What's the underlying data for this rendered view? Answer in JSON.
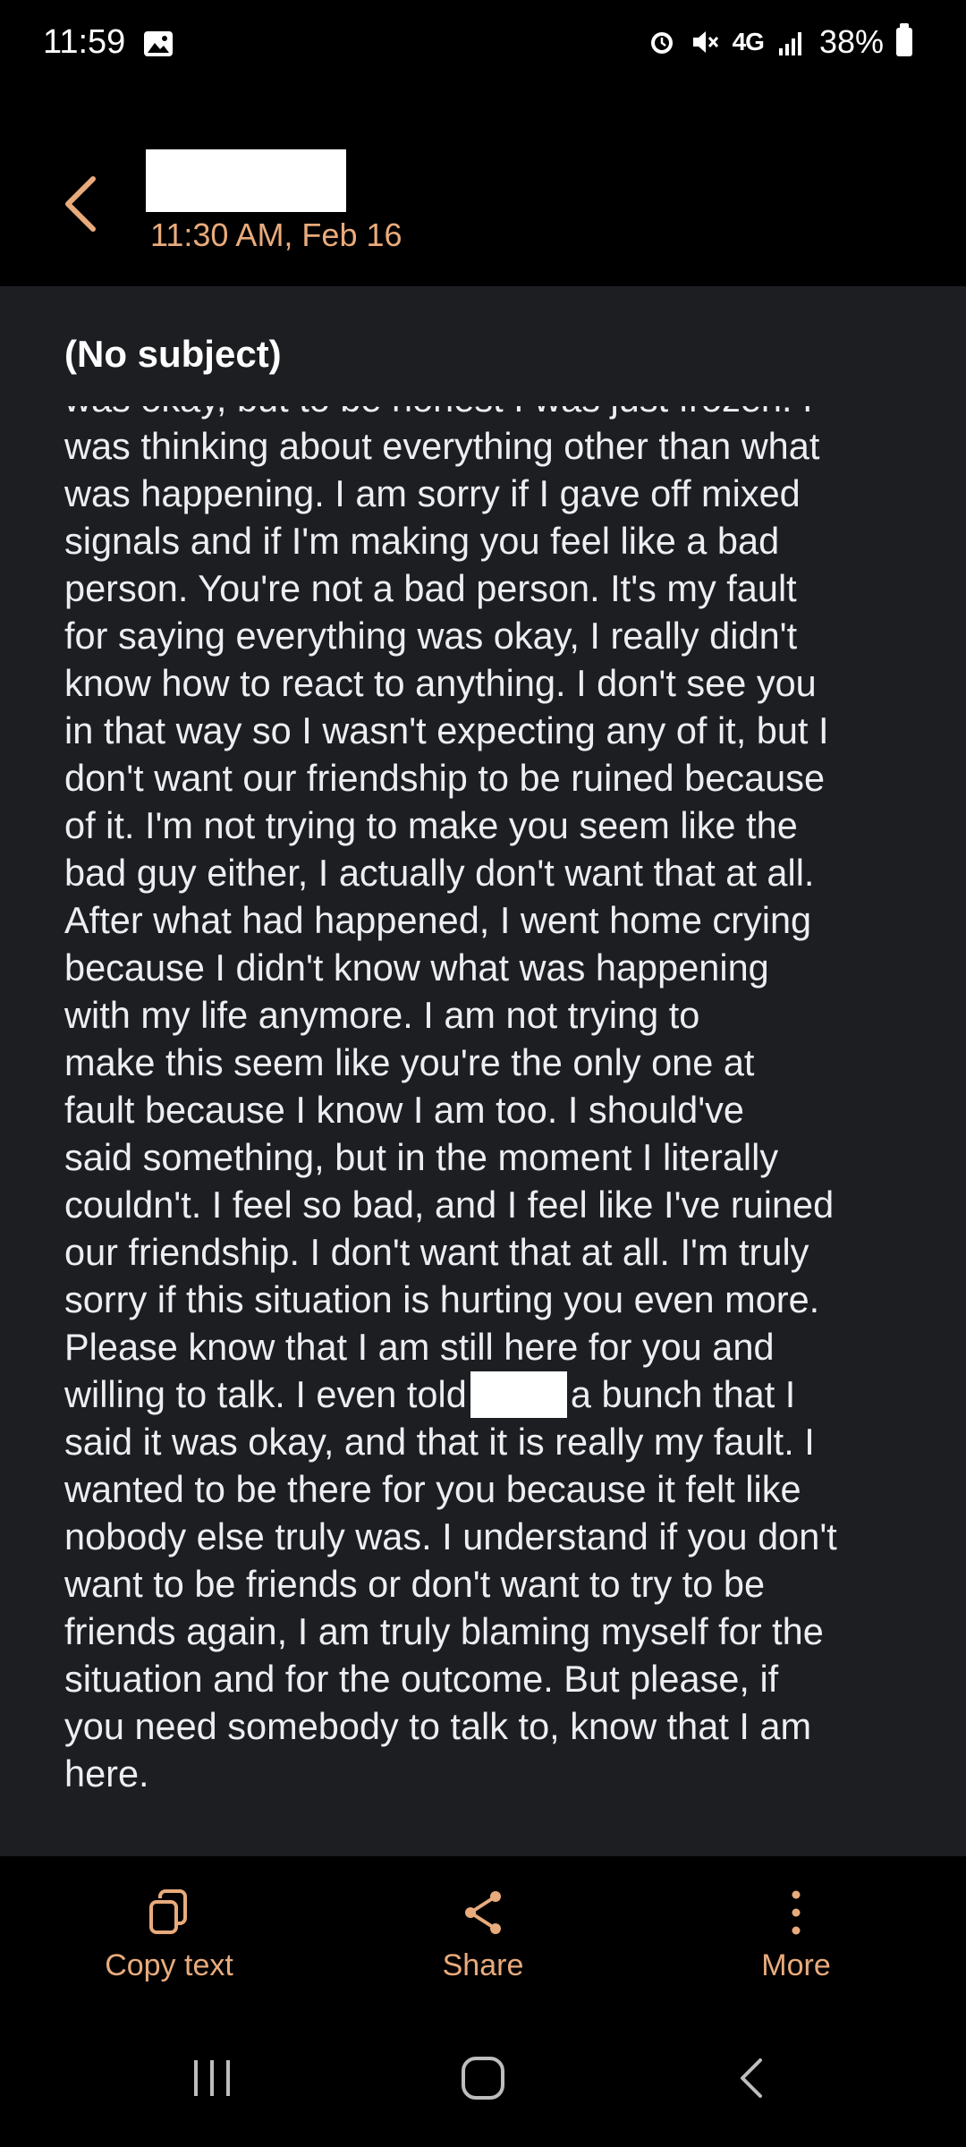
{
  "status_bar": {
    "time": "11:59",
    "network": "4G",
    "battery": "38%"
  },
  "header": {
    "date": "11:30 AM, Feb 16"
  },
  "message": {
    "subject": "(No subject)",
    "partial_top_line": "was okay, but to be honest I was just frozen. I",
    "lines": [
      "was thinking about everything other than what",
      "was happening. I am sorry if I gave off mixed",
      "signals and if I'm making you feel like a bad",
      "person. You're not a bad person. It's my fault",
      "for saying everything was okay, I really didn't",
      "know how to react to anything. I don't see you",
      "in that way so I wasn't expecting any of it, but I",
      "don't want our friendship to be ruined because",
      "of it. I'm not trying to make you seem like the",
      "bad guy either, I actually don't want that at all.",
      "After what had happened, I went home crying",
      "because I didn't know what was happening",
      "with my life anymore. I am not trying to",
      "make this seem like you're the only one at",
      "fault because I know I am too. I should've",
      "said something, but in the moment I literally",
      "couldn't. I feel so bad, and I feel like I've ruined",
      "our friendship. I don't want that at all. I'm truly",
      "sorry if this situation is hurting you even more.",
      "Please know that I am still here for you and"
    ],
    "redacted_line_before": "willing to talk. I even told",
    "redacted_line_after": "a bunch that I",
    "lines_after": [
      "said it was okay, and that it is really my fault. I",
      "wanted to be there for you because it felt like",
      "nobody else truly was. I understand if you don't",
      "want to be friends or don't want to try to be",
      "friends again, I am truly blaming myself for the",
      "situation and for the outcome. But please, if",
      "you need somebody to talk to, know that I am",
      "here."
    ]
  },
  "actions": {
    "copy": "Copy text",
    "share": "Share",
    "more": "More"
  },
  "colors": {
    "accent": "#e9ab7c",
    "message_bg": "#1c1e22",
    "background": "#000000"
  },
  "icons": [
    "gallery-icon",
    "alarm-icon",
    "mute-icon",
    "signal-icon",
    "battery-icon",
    "back-arrow-icon",
    "copy-icon",
    "share-icon",
    "more-icon",
    "recents-icon",
    "home-icon",
    "back-icon"
  ]
}
